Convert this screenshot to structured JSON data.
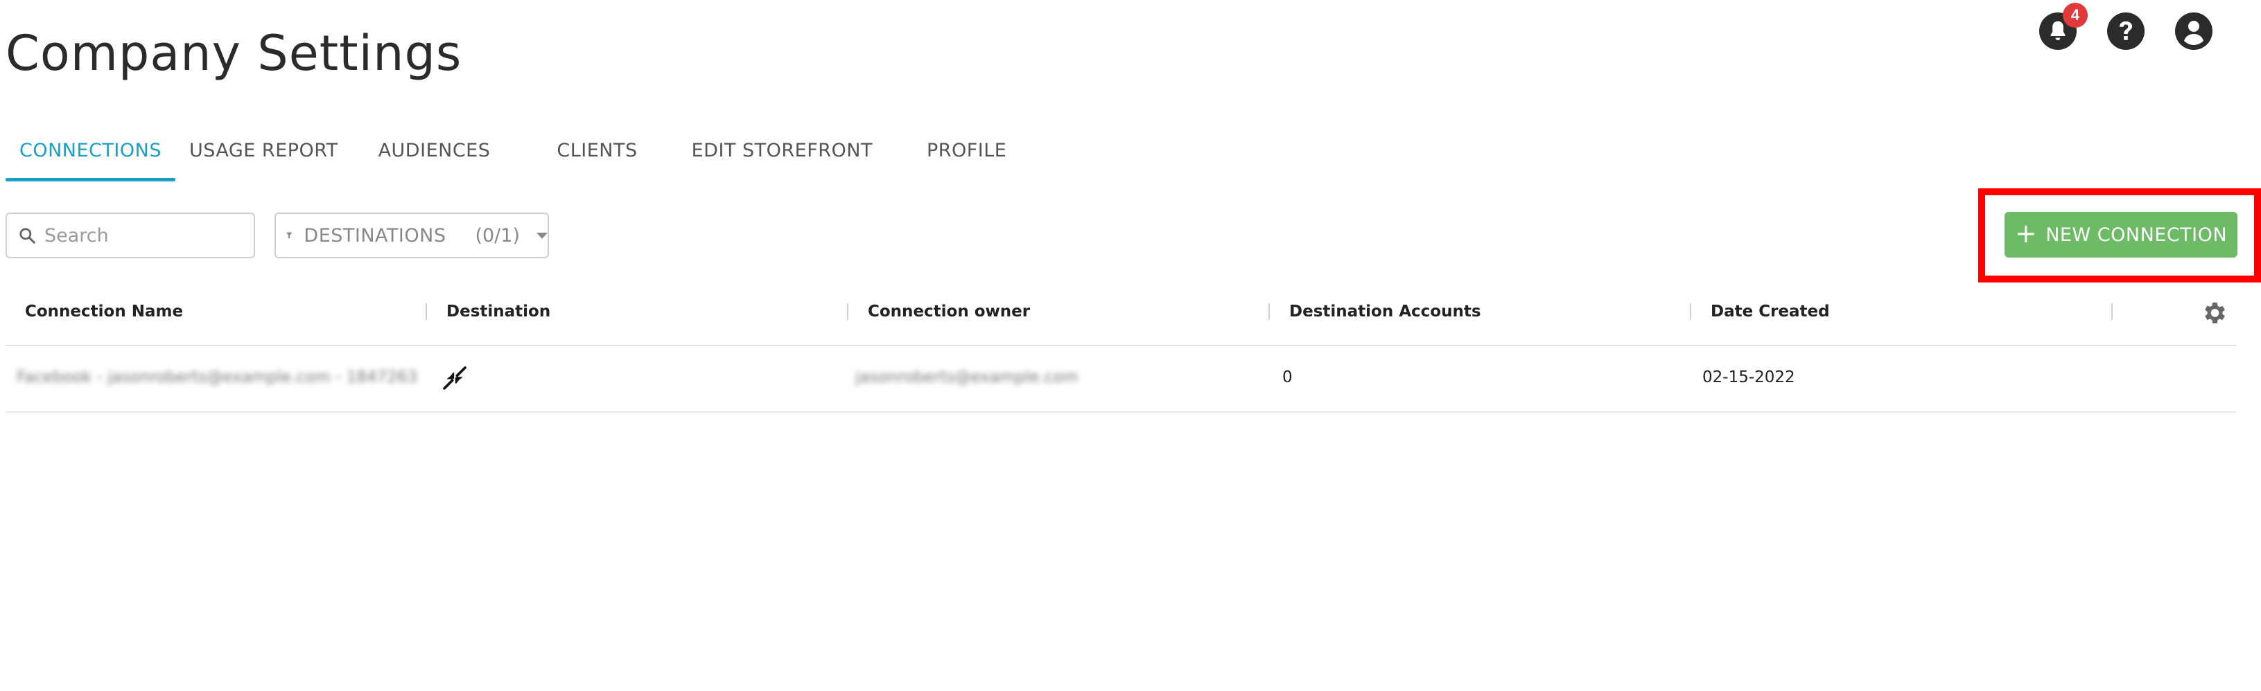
{
  "page": {
    "title": "Company Settings"
  },
  "header": {
    "notification_count": "4",
    "icons": [
      "bell-icon",
      "help-icon",
      "account-icon"
    ]
  },
  "tabs": [
    {
      "label": "CONNECTIONS",
      "active": true
    },
    {
      "label": "USAGE REPORT",
      "active": false
    },
    {
      "label": "AUDIENCES",
      "active": false
    },
    {
      "label": "CLIENTS",
      "active": false
    },
    {
      "label": "EDIT STOREFRONT",
      "active": false
    },
    {
      "label": "PROFILE",
      "active": false
    }
  ],
  "toolbar": {
    "search_placeholder": "Search",
    "filter_label": "DESTINATIONS",
    "filter_count": "(0/1)",
    "new_connection_label": "NEW CONNECTION"
  },
  "table": {
    "columns": [
      "Connection Name",
      "Destination",
      "Connection owner",
      "Destination Accounts",
      "Date Created"
    ],
    "rows": [
      {
        "connection_name": "Facebook - jasonroberts@example.com - 1847263",
        "destination_icon": "compress-arrows-icon",
        "connection_owner": "jasonroberts@example.com",
        "destination_accounts": "0",
        "date_created": "02-15-2022"
      }
    ]
  },
  "colors": {
    "accent": "#1a9fc9",
    "primary_button": "#6dbb66",
    "badge": "#e03a3a",
    "highlight": "#ff0000"
  }
}
